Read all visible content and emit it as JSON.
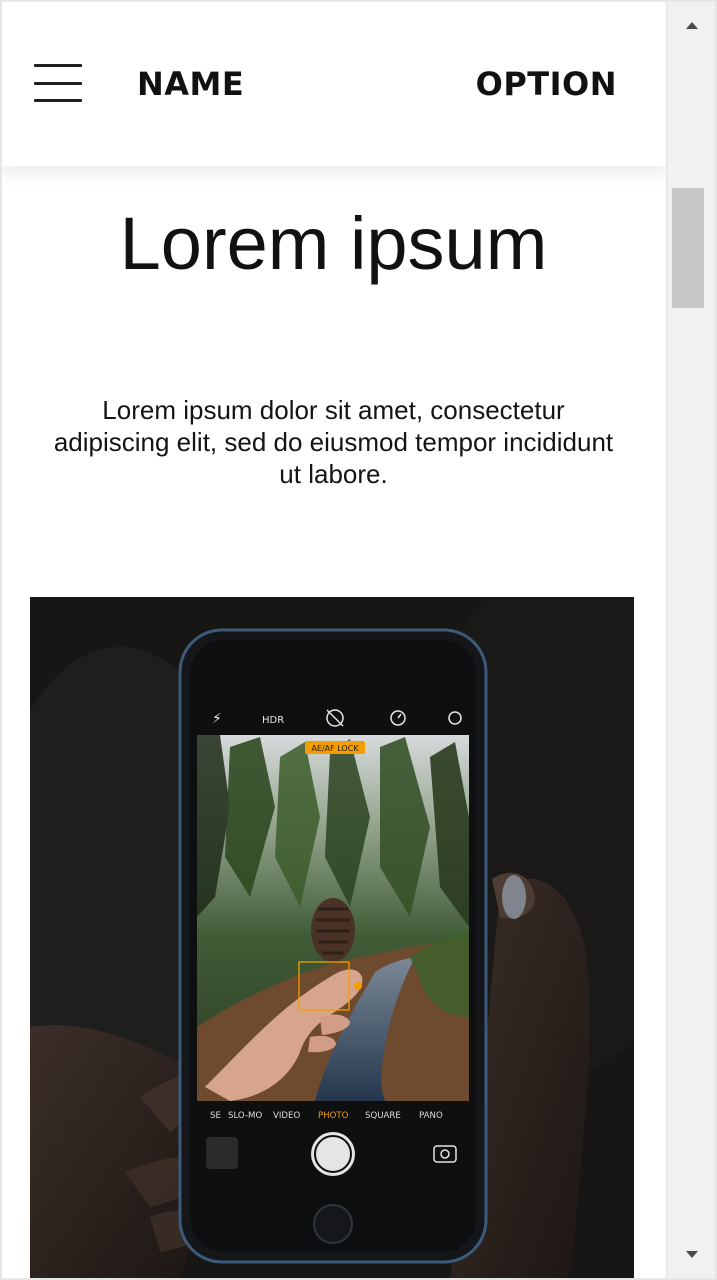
{
  "header": {
    "brand": "NAME",
    "option": "OPTION"
  },
  "hero": {
    "title": "Lorem ipsum",
    "text": "Lorem ipsum dolor sit amet, consectetur adipiscing elit, sed do eiusmod tempor incididunt ut labore."
  },
  "photo": {
    "camera_top": [
      "HDR"
    ],
    "focus_badge": "AE/AF LOCK",
    "modes": [
      "SE",
      "SLO-MO",
      "VIDEO",
      "PHOTO",
      "SQUARE",
      "PANO"
    ],
    "active_mode": "PHOTO",
    "accent": "#f49d00"
  },
  "scrollbar": {
    "thumb_color": "#c8c8c8"
  }
}
